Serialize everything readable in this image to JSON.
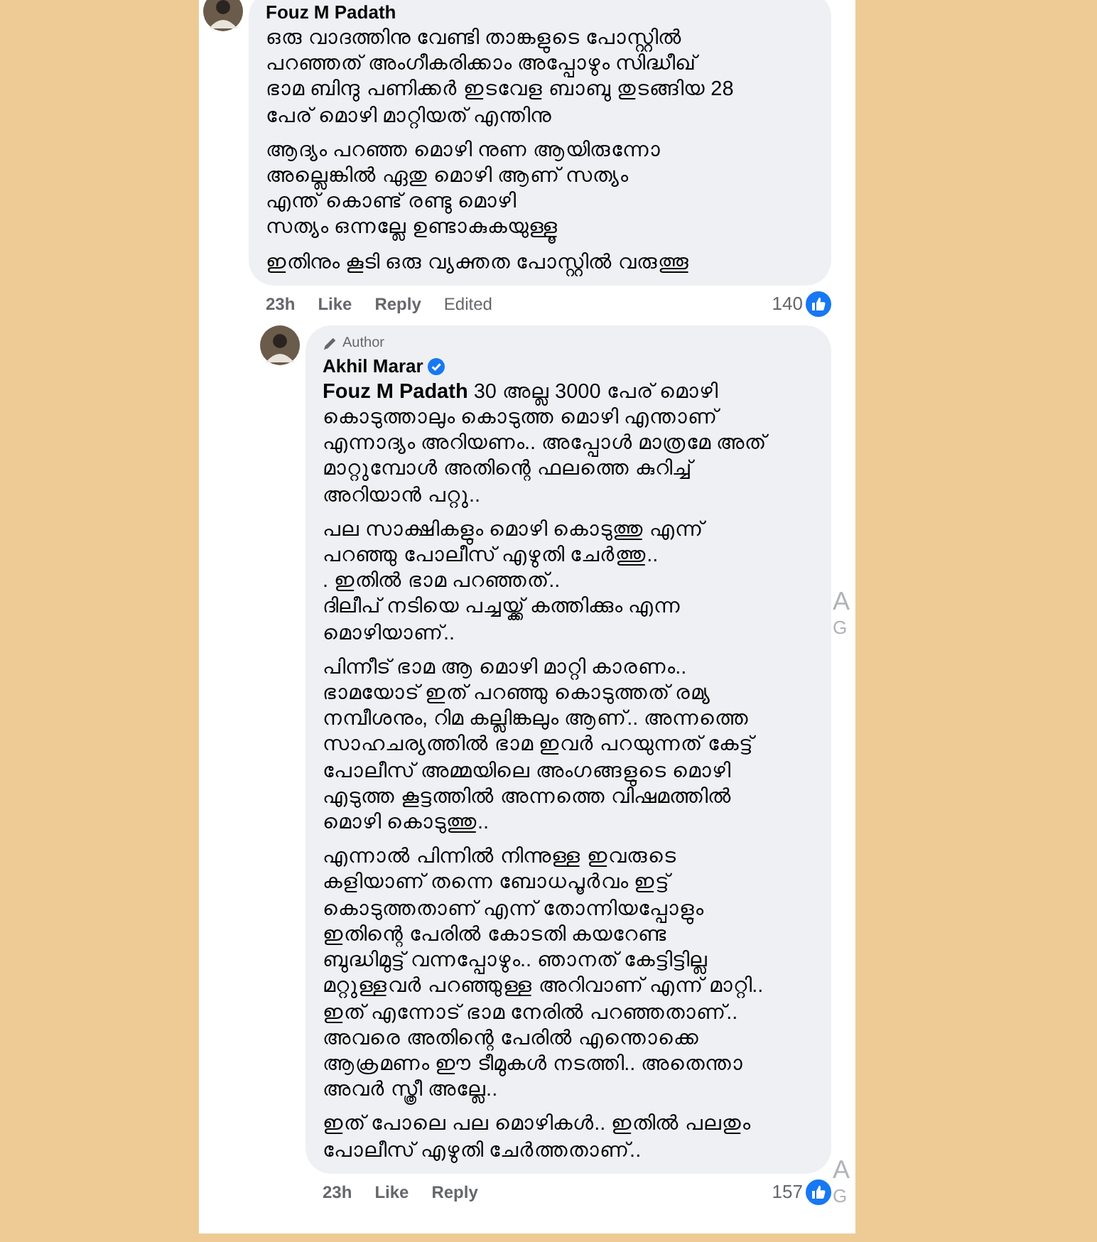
{
  "comments": [
    {
      "author": "Fouz M Padath",
      "paragraphs": [
        "ഒരു വാദത്തിനു വേണ്ടി താങ്കളുടെ പോസ്റ്റിൽ\nപറഞ്ഞത് അംഗീകരിക്കാം അപ്പോഴും സിദ്ധീഖ്\nഭാമ ബിന്ദു പണിക്കർ ഇടവേള ബാബു തുടങ്ങിയ 28\nപേര് മൊഴി മാറ്റിയത് എന്തിനു",
        "ആദ്യം പറഞ്ഞ മൊഴി നുണ ആയിരുന്നോ\nഅല്ലെങ്കിൽ ഏതു മൊഴി ആണ് സത്യം\nഎന്ത് കൊണ്ട് രണ്ടു മൊഴി\nസത്യം ഒന്നല്ലേ ഉണ്ടാകുകയുള്ളൂ",
        "ഇതിനും കൂടി ഒരു വ്യക്തത പോസ്റ്റിൽ വരുത്തൂ"
      ],
      "time": "23h",
      "like": "Like",
      "reply": "Reply",
      "edited": "Edited",
      "reactions": "140",
      "children": [
        {
          "author": "Akhil Marar",
          "badge": "Author",
          "verified": true,
          "paragraphs": [
            "**Fouz M Padath** 30 അല്ല 3000 പേര് മൊഴി\nകൊടുത്താലും കൊടുത്ത മൊഴി എന്താണ്\nഎന്നാദ്യം അറിയണം.. അപ്പോൾ മാത്രമേ അത്\nമാറ്റുമ്പോൾ അതിന്റെ ഫലത്തെ കുറിച്ച്\nഅറിയാൻ പറ്റു..",
            "പല സാക്ഷികളും മൊഴി കൊടുത്തു എന്ന്\nപറഞ്ഞു പോലീസ് എഴുതി ചേർത്തു..\n. ഇതിൽ ഭാമ പറഞ്ഞത്..\nദിലീപ് നടിയെ പച്ചയ്ക്ക് കത്തിക്കും എന്ന\nമൊഴിയാണ്..",
            "പിന്നീട് ഭാമ ആ മൊഴി മാറ്റി കാരണം..\nഭാമയോട് ഇത് പറഞ്ഞു കൊടുത്തത് രമ്യ\nനമ്പീശനും, റിമ കല്ലിങ്കലും ആണ്.. അന്നത്തെ\nസാഹചര്യത്തിൽ ഭാമ ഇവർ പറയുന്നത് കേട്ട്\nപോലീസ് അമ്മയിലെ അംഗങ്ങളുടെ മൊഴി\nഎടുത്ത കൂട്ടത്തിൽ അന്നത്തെ വിഷമത്തിൽ\nമൊഴി കൊടുത്തു..",
            "എന്നാൽ പിന്നിൽ നിന്നുള്ള ഇവരുടെ\nകളിയാണ് തന്നെ ബോധപൂർവം ഇട്ട്\nകൊടുത്തതാണ് എന്ന് തോന്നിയപ്പോളും\nഇതിന്റെ പേരിൽ കോടതി കയറേണ്ട\nബുദ്ധിമുട്ട് വന്നപ്പോഴും.. ഞാനത് കേട്ടിട്ടില്ല\nമറ്റുള്ളവർ പറഞ്ഞുള്ള അറിവാണ് എന്ന് മാറ്റി..\nഇത് എന്നോട് ഭാമ നേരിൽ പറഞ്ഞതാണ്..\nഅവരെ അതിന്റെ പേരിൽ എന്തൊക്കെ\nആക്രമണം ഈ ടീമുകൾ നടത്തി.. അതെന്താ\nഅവർ സ്ത്രീ അല്ലേ..",
            "ഇത് പോലെ പല മൊഴികൾ.. ഇതിൽ പലതും\nപോലീസ് എഴുതി ചേർത്തതാണ്.."
          ],
          "time": "23h",
          "like": "Like",
          "reply": "Reply",
          "reactions": "157"
        }
      ]
    }
  ],
  "side_texts": [
    "A",
    "G",
    "A",
    "G"
  ]
}
